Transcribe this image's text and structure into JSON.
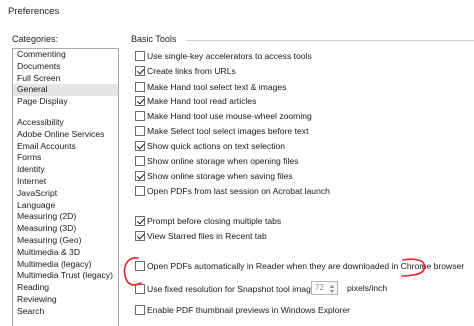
{
  "window": {
    "title": "Preferences"
  },
  "categories": {
    "label": "Categories:",
    "top_items": [
      "Commenting",
      "Documents",
      "Full Screen",
      "General",
      "Page Display"
    ],
    "selected": "General",
    "items": [
      "Accessibility",
      "Adobe Online Services",
      "Email Accounts",
      "Forms",
      "Identity",
      "Internet",
      "JavaScript",
      "Language",
      "Measuring (2D)",
      "Measuring (3D)",
      "Measuring (Geo)",
      "Multimedia & 3D",
      "Multimedia (legacy)",
      "Multimedia Trust (legacy)",
      "Reading",
      "Reviewing",
      "Search"
    ]
  },
  "basic_tools": {
    "label": "Basic Tools",
    "options": [
      {
        "label": "Use single-key accelerators to access tools",
        "checked": false
      },
      {
        "label": "Create links from URLs",
        "checked": true
      },
      {
        "label": "Make Hand tool select text & images",
        "checked": false
      },
      {
        "label": "Make Hand tool read articles",
        "checked": true
      },
      {
        "label": "Make Hand tool use mouse-wheel zooming",
        "checked": false
      },
      {
        "label": "Make Select tool select images before text",
        "checked": false
      },
      {
        "label": "Show quick actions on text selection",
        "checked": true
      },
      {
        "label": "Show online storage when opening files",
        "checked": false
      },
      {
        "label": "Show online storage when saving files",
        "checked": true
      },
      {
        "label": "Open PDFs from last session on Acrobat launch",
        "checked": false
      },
      {
        "label": "Prompt before closing multiple tabs",
        "checked": true
      },
      {
        "label": "View Starred files in Recent tab",
        "checked": true
      },
      {
        "label": "Open PDFs automatically in Reader when they are downloaded in Chrome browser",
        "checked": false
      },
      {
        "label": "Use fixed resolution for Snapshot tool images:",
        "checked": false
      },
      {
        "label": "Enable PDF thumbnail previews in Windows Explorer",
        "checked": false
      }
    ]
  },
  "snapshot_resolution": {
    "value": "72",
    "unit": "pixels/inch"
  },
  "annotation": {
    "color": "#e0262b"
  }
}
